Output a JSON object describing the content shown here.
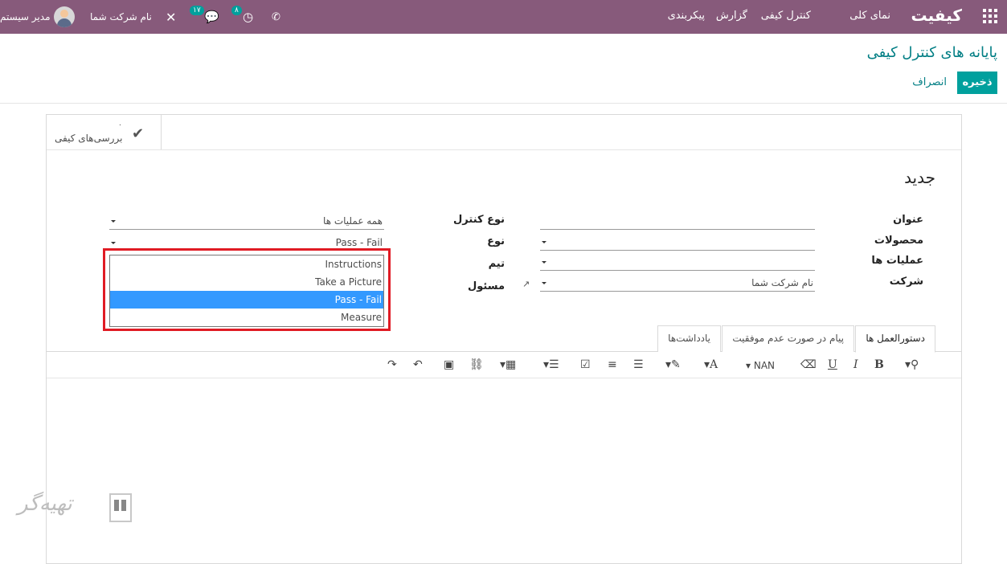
{
  "navbar": {
    "brand": "کیفیت",
    "menu": {
      "overview": "نمای کلی",
      "quality_control": "کنترل کیفی",
      "reporting": "گزارش",
      "configuration": "پیکربندی"
    },
    "user_name": "مدیر سیستم",
    "company": "نام شرکت شما",
    "messages_count": "۱۷",
    "activities_count": "۸"
  },
  "control_panel": {
    "breadcrumb": "پایانه های کنترل کیفی",
    "save_label": "ذخیره",
    "discard_label": "انصراف"
  },
  "smart_button": {
    "label": "بررسی‌های کیفی",
    "count": "۰"
  },
  "form": {
    "record_name": "جدید",
    "left_labels": {
      "title": "عنوان",
      "products": "محصولات",
      "operations": "عملیات ها",
      "company": "شرکت"
    },
    "right_labels": {
      "control_type": "نوع کنترل",
      "type": "نوع",
      "team": "تیم",
      "responsible": "مسئول"
    },
    "values": {
      "title": "",
      "products": "",
      "operations": "",
      "company": "نام شرکت شما",
      "control_type": "همه عملیات ها",
      "type": "Pass - Fail"
    }
  },
  "type_dropdown": {
    "options": [
      "Instructions",
      "Take a Picture",
      "Pass - Fail",
      "Measure"
    ],
    "selected": "Pass - Fail"
  },
  "tabs": {
    "instructions": "دستورالعمل ها",
    "failure_message": "پیام در صورت عدم موفقیت",
    "notes": "یادداشت‌ها"
  },
  "toolbar": {
    "font_size": "NAN"
  },
  "watermark": {
    "text": "تهیه‌گر"
  }
}
